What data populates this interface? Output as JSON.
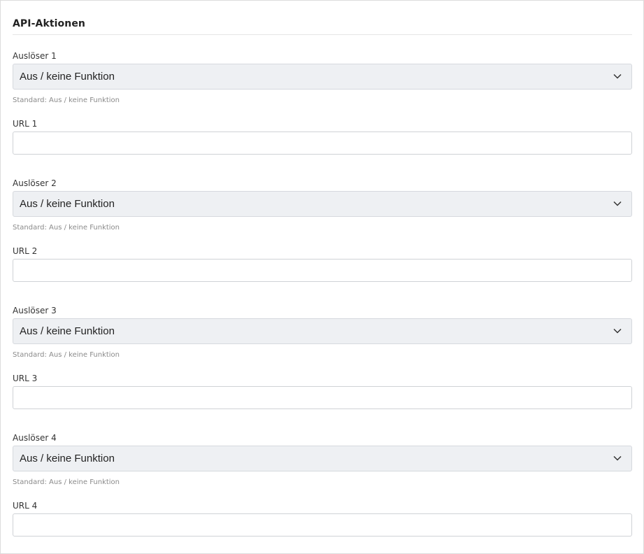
{
  "section": {
    "title": "API-Aktionen"
  },
  "triggers": [
    {
      "trigger_label": "Auslöser 1",
      "selected": "Aus / keine Funktion",
      "hint": "Standard: Aus / keine Funktion",
      "url_label": "URL 1",
      "url_value": ""
    },
    {
      "trigger_label": "Auslöser 2",
      "selected": "Aus / keine Funktion",
      "hint": "Standard: Aus / keine Funktion",
      "url_label": "URL 2",
      "url_value": ""
    },
    {
      "trigger_label": "Auslöser 3",
      "selected": "Aus / keine Funktion",
      "hint": "Standard: Aus / keine Funktion",
      "url_label": "URL 3",
      "url_value": ""
    },
    {
      "trigger_label": "Auslöser 4",
      "selected": "Aus / keine Funktion",
      "hint": "Standard: Aus / keine Funktion",
      "url_label": "URL 4",
      "url_value": ""
    }
  ],
  "icons": {
    "select_arrow": "chevron-down-icon"
  },
  "colors": {
    "select_background": "#eef0f3",
    "border": "#cfd2d6",
    "hint_text": "#8a8a8a"
  }
}
